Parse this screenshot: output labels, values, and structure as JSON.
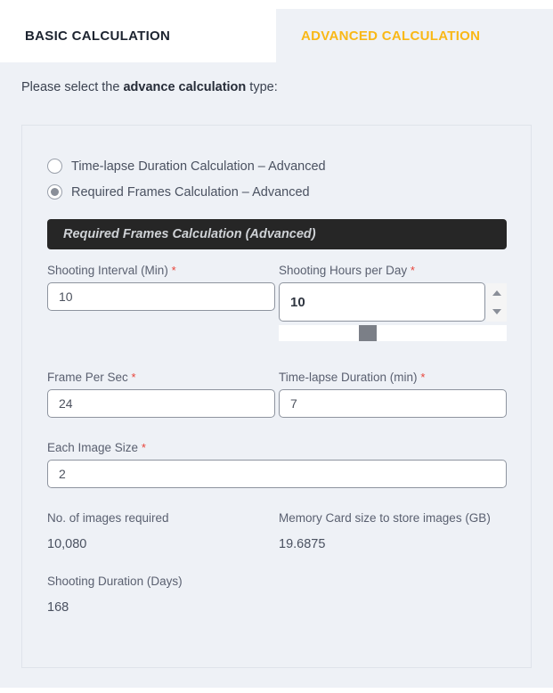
{
  "tabs": [
    {
      "label": "BASIC CALCULATION",
      "active": false,
      "name": "tab-basic"
    },
    {
      "label": "ADVANCED CALCULATION",
      "active": true,
      "name": "tab-advanced"
    }
  ],
  "prompt": {
    "before": "Please select the ",
    "strong": "advance calculation",
    "after": " type:"
  },
  "radios": [
    {
      "label": "Time-lapse Duration Calculation – Advanced",
      "checked": false
    },
    {
      "label": "Required Frames Calculation – Advanced",
      "checked": true
    }
  ],
  "section_header": "Required Frames Calculation (Advanced)",
  "fields": {
    "shooting_interval": {
      "label": "Shooting Interval (Min)",
      "required": "*",
      "value": "10"
    },
    "shooting_hours_per_day": {
      "label": "Shooting Hours per Day",
      "required": "*",
      "value": "10",
      "slider_percent": 38
    },
    "frame_per_sec": {
      "label": "Frame Per Sec",
      "required": "*",
      "value": "24"
    },
    "timelapse_duration": {
      "label": "Time-lapse Duration (min)",
      "required": "*",
      "value": "7"
    },
    "each_image_size": {
      "label": "Each Image Size",
      "required": "*",
      "value": "2"
    }
  },
  "results": [
    {
      "label": "No. of images required",
      "value": "10,080"
    },
    {
      "label": "Memory Card size to store images (GB)",
      "value": "19.6875"
    },
    {
      "label": "Shooting Duration (Days)",
      "value": "168"
    }
  ],
  "colors": {
    "accent": "#f9b817",
    "page_bg": "#eef1f6",
    "tab_active_bg": "#ffffff",
    "section_header_bg": "#262626",
    "required_star": "#e8443a"
  }
}
